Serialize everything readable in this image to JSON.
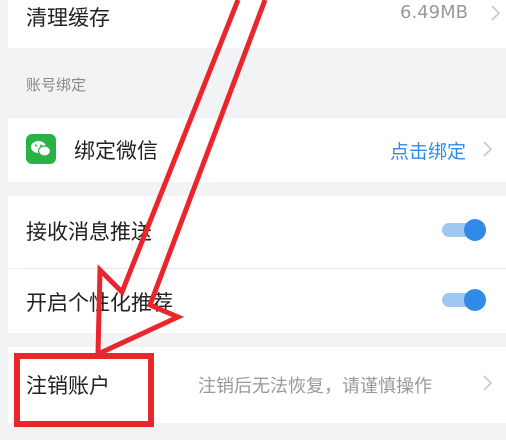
{
  "clear_cache": {
    "label": "清理缓存",
    "size": "6.49MB"
  },
  "account_binding": {
    "section_title": "账号绑定",
    "wechat": {
      "label": "绑定微信",
      "action": "点击绑定",
      "icon": "wechat-icon"
    }
  },
  "notifications": {
    "receive_push": {
      "label": "接收消息推送",
      "enabled": true
    },
    "personalized": {
      "label": "开启个性化推荐",
      "enabled": true
    }
  },
  "delete_account": {
    "label": "注销账户",
    "hint": "注销后无法恢复，请谨慎操作"
  },
  "colors": {
    "accent": "#2f8ae8",
    "annotation_red": "#e8262b",
    "wechat_green": "#2bb245"
  }
}
